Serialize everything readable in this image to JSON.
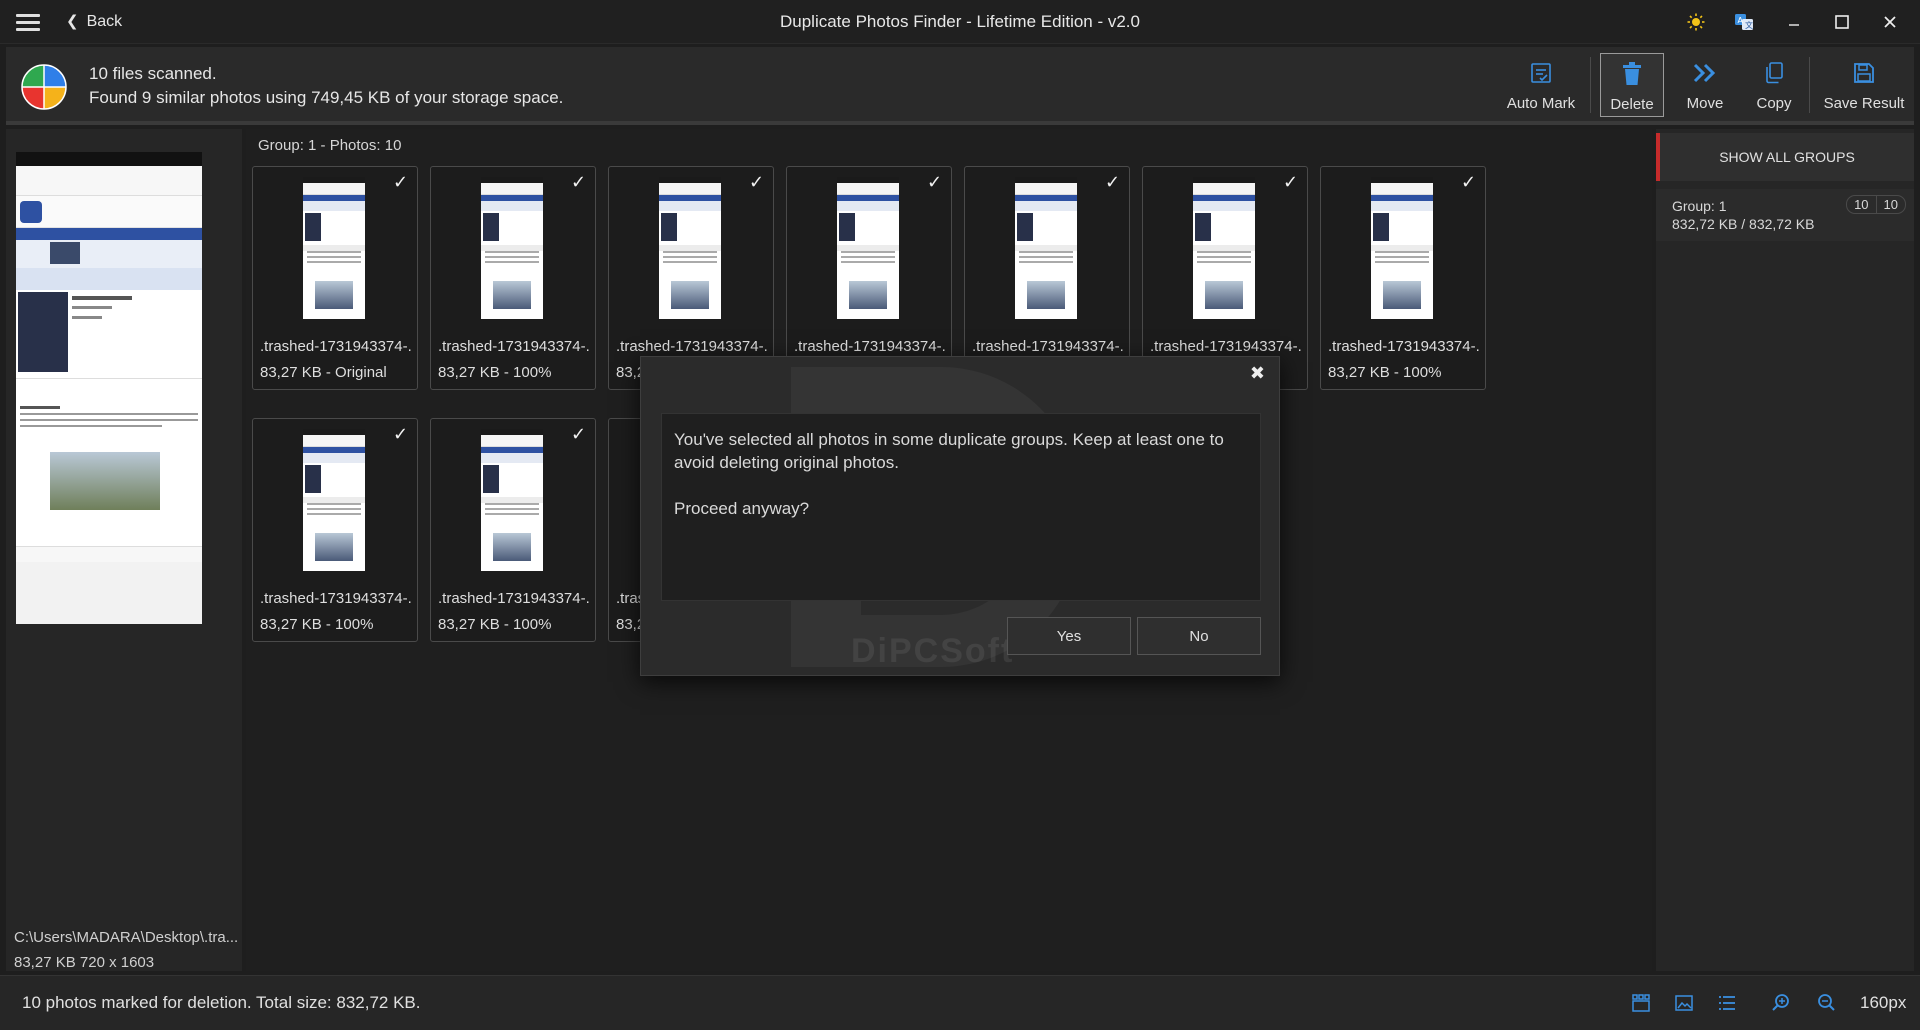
{
  "window": {
    "title": "Duplicate Photos Finder - Lifetime Edition - v2.0",
    "back_label": "Back"
  },
  "header": {
    "status_line1": "10 files scanned.",
    "status_line2": "Found 9 similar photos using 749,45 KB of your storage space.",
    "actions": [
      {
        "label": "Auto Mark",
        "icon": "auto-mark-icon"
      },
      {
        "label": "Delete",
        "icon": "trash-icon"
      },
      {
        "label": "Move",
        "icon": "move-icon"
      },
      {
        "label": "Copy",
        "icon": "copy-icon"
      },
      {
        "label": "Save Result",
        "icon": "save-icon"
      }
    ]
  },
  "preview": {
    "path": "C:\\Users\\MADARA\\Desktop\\.tra...",
    "file_info": "83,27 KB  720 x 1603"
  },
  "group": {
    "header": "Group: 1 - Photos: 10",
    "photos": [
      {
        "name": ".trashed-1731943374-...",
        "size": "83,27 KB - Original"
      },
      {
        "name": ".trashed-1731943374-...",
        "size": "83,27 KB - 100%"
      },
      {
        "name": ".trashed-1731943374-...",
        "size": "83,2"
      },
      {
        "name": ".trashed-1731943374-...",
        "size": ""
      },
      {
        "name": ".trashed-1731943374-...",
        "size": ""
      },
      {
        "name": ".trashed-1731943374-...",
        "size": ""
      },
      {
        "name": ".trashed-1731943374-...",
        "size": "83,27 KB - 100%"
      },
      {
        "name": ".trashed-1731943374-...",
        "size": "83,27 KB - 100%"
      },
      {
        "name": ".trashed-1731943374-...",
        "size": "83,27 KB - 100%"
      },
      {
        "name": ".tras",
        "size": "83,2"
      }
    ]
  },
  "rightpanel": {
    "show_all": "SHOW ALL GROUPS",
    "group_title": "Group: 1",
    "group_size": "832,72 KB / 832,72 KB",
    "badge_a": "10",
    "badge_b": "10"
  },
  "dialog": {
    "message_line1": "You've selected all photos in some duplicate groups. Keep at least one to avoid deleting original photos.",
    "message_line2": "Proceed anyway?",
    "yes": "Yes",
    "no": "No",
    "watermark": "DiPCSoft"
  },
  "statusbar": {
    "message": "10 photos marked for deletion. Total size: 832,72 KB.",
    "zoom": "160px"
  },
  "colors": {
    "accent_blue": "#3a8fe0",
    "selected_red": "#c62b2b"
  }
}
